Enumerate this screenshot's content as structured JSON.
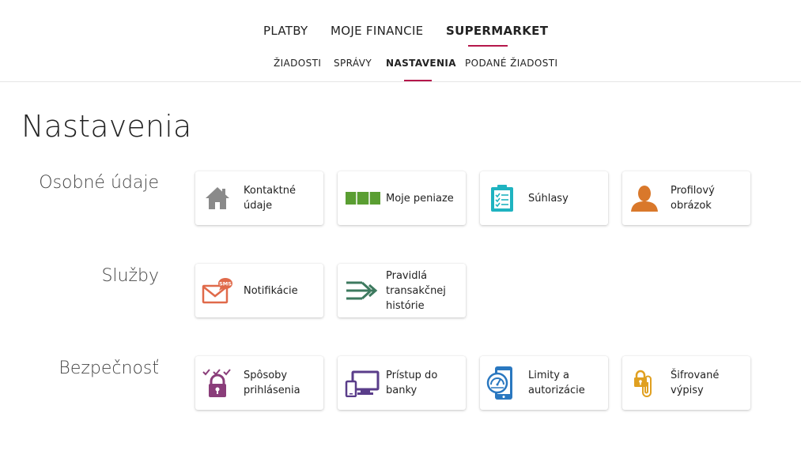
{
  "main_tabs": [
    {
      "label": "PLATBY"
    },
    {
      "label": "MOJE FINANCIE"
    },
    {
      "label": "SUPERMARKET"
    }
  ],
  "sub_tabs": [
    {
      "label": "ŽIADOSTI"
    },
    {
      "label": "SPRÁVY"
    },
    {
      "label": "NASTAVENIA"
    },
    {
      "label": "PODANÉ ŽIADOSTI"
    }
  ],
  "page_title": "Nastavenia",
  "sections": [
    {
      "title": "Osobné údaje",
      "cards": [
        {
          "label": "Kontaktné údaje",
          "icon": "home-icon"
        },
        {
          "label": "Moje peniaze",
          "icon": "money-icon"
        },
        {
          "label": "Súhlasy",
          "icon": "clipboard-checklist-icon"
        },
        {
          "label": "Profilový obrázok",
          "icon": "person-icon"
        }
      ]
    },
    {
      "title": "Služby",
      "cards": [
        {
          "label": "Notifikácie",
          "icon": "sms-envelope-icon"
        },
        {
          "label": "Pravidlá transakčnej histórie",
          "icon": "arrows-rules-icon"
        }
      ]
    },
    {
      "title": "Bezpečnosť",
      "cards": [
        {
          "label": "Spôsoby prihlásenia",
          "icon": "padlock-checks-icon"
        },
        {
          "label": "Prístup do banky",
          "icon": "devices-icon"
        },
        {
          "label": "Limity a autorizácie",
          "icon": "phone-gauge-icon"
        },
        {
          "label": "Šifrované výpisy",
          "icon": "lock-paperclip-icon"
        }
      ]
    }
  ],
  "colors": {
    "accent": "#b5174b",
    "home": "#8a8a8a",
    "money": "#5a9e32",
    "clipboard": "#1fb3c0",
    "person": "#d9782b",
    "sms": "#e06a4a",
    "arrows": "#3d7a5f",
    "padlock": "#8a3d7a",
    "devices": "#5a3d8a",
    "phone": "#2a78c0",
    "lock_clip": "#e0a020"
  }
}
